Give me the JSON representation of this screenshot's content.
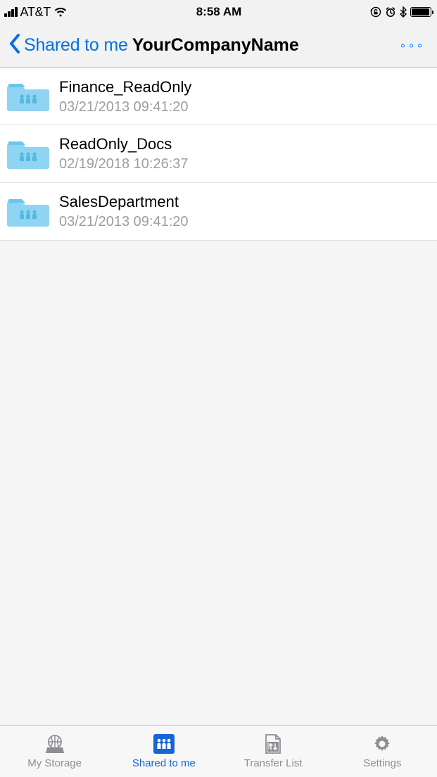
{
  "status": {
    "carrier": "AT&T",
    "time": "8:58 AM"
  },
  "nav": {
    "back_label": "Shared to me",
    "title": "YourCompanyName"
  },
  "folders": [
    {
      "name": "Finance_ReadOnly",
      "date": "03/21/2013 09:41:20"
    },
    {
      "name": "ReadOnly_Docs",
      "date": "02/19/2018 10:26:37"
    },
    {
      "name": "SalesDepartment",
      "date": "03/21/2013 09:41:20"
    }
  ],
  "tabs": {
    "my_storage": "My Storage",
    "shared_to_me": "Shared to me",
    "transfer_list": "Transfer List",
    "settings": "Settings"
  },
  "colors": {
    "folder_fill": "#8fd4f2",
    "folder_top": "#69c6ec",
    "accent": "#1565d8",
    "ios_blue": "#0a84ff"
  }
}
